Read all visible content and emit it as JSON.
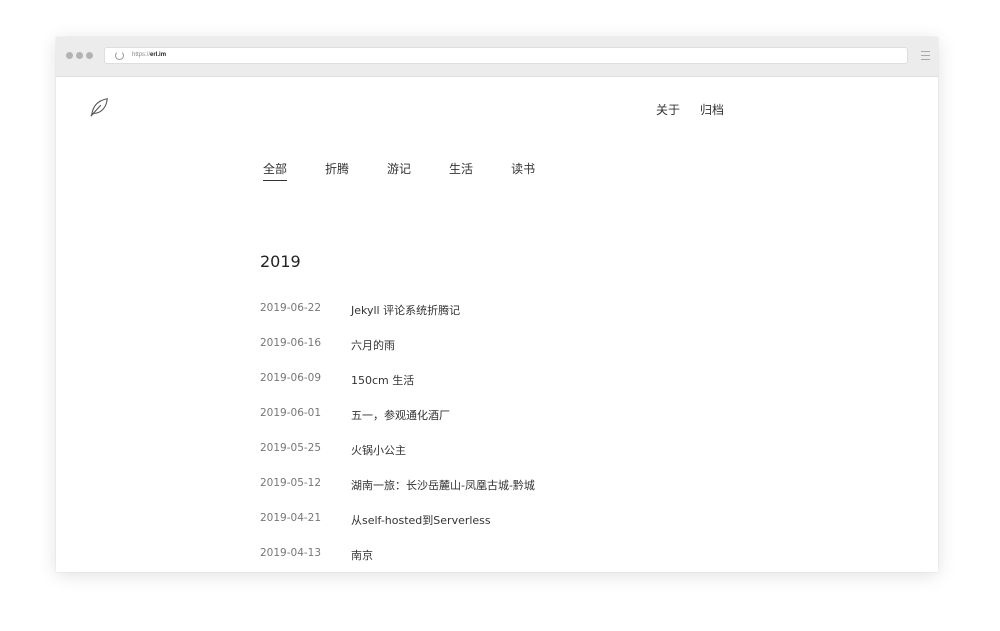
{
  "browser": {
    "url_prefix": "https://",
    "url_host": "erl.im"
  },
  "nav": {
    "items": [
      {
        "label": "关于"
      },
      {
        "label": "归档"
      }
    ]
  },
  "tabs": [
    {
      "label": "全部",
      "active": true
    },
    {
      "label": "折腾",
      "active": false
    },
    {
      "label": "游记",
      "active": false
    },
    {
      "label": "生活",
      "active": false
    },
    {
      "label": "读书",
      "active": false
    }
  ],
  "archive": {
    "year": "2019",
    "posts": [
      {
        "date": "2019-06-22",
        "title": "Jekyll 评论系统折腾记"
      },
      {
        "date": "2019-06-16",
        "title": "六月的雨"
      },
      {
        "date": "2019-06-09",
        "title": "150cm 生活"
      },
      {
        "date": "2019-06-01",
        "title": "五一，参观通化酒厂"
      },
      {
        "date": "2019-05-25",
        "title": "火锅小公主"
      },
      {
        "date": "2019-05-12",
        "title": "湖南一旅：长沙岳麓山-凤凰古城-黔城"
      },
      {
        "date": "2019-04-21",
        "title": "从self-hosted到Serverless"
      },
      {
        "date": "2019-04-13",
        "title": "南京"
      }
    ]
  }
}
